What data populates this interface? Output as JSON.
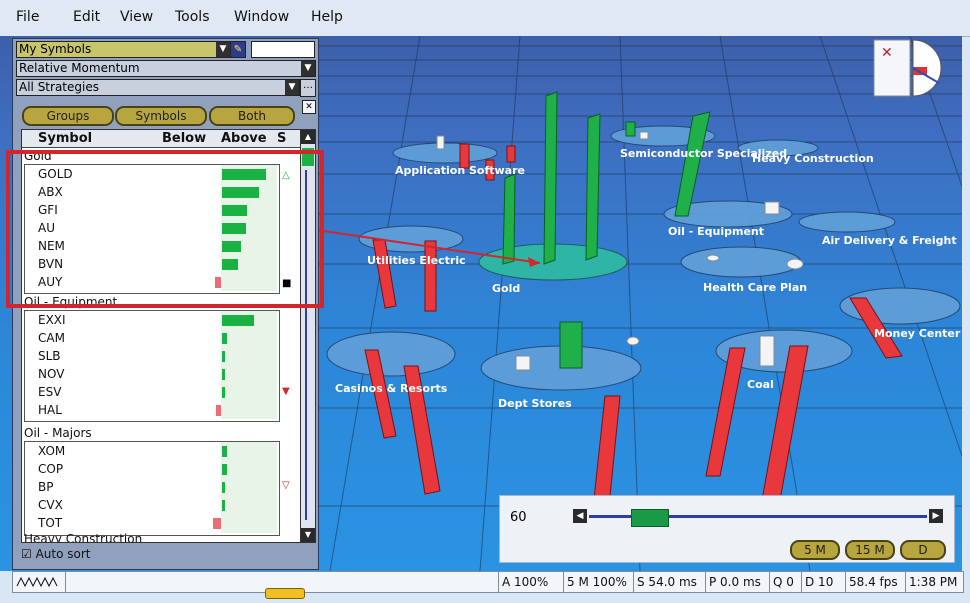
{
  "menu": [
    "File",
    "Edit",
    "View",
    "Tools",
    "Window",
    "Help"
  ],
  "panel": {
    "combo_symbols": "My Symbols",
    "combo_indicator": "Relative Momentum",
    "combo_strategy": "All Strategies",
    "btn_groups": "Groups",
    "btn_symbols": "Symbols",
    "btn_both": "Both",
    "col_symbol": "Symbol",
    "col_below": "Below",
    "col_above": "Above",
    "col_s": "S",
    "group_gold": "Gold",
    "group_oil_equipment": "Oil - Equipment",
    "group_oil_majors": "Oil - Majors",
    "group_heavy": "Heavy Construction",
    "autosort_label": "Auto sort",
    "rows_gold": [
      {
        "symbol": "GOLD",
        "above": 0.82
      },
      {
        "symbol": "ABX",
        "above": 0.68
      },
      {
        "symbol": "GFI",
        "above": 0.47
      },
      {
        "symbol": "AU",
        "above": 0.45
      },
      {
        "symbol": "NEM",
        "above": 0.35
      },
      {
        "symbol": "BVN",
        "above": 0.3
      },
      {
        "symbol": "AUY",
        "below": 0.12
      }
    ],
    "rows_oil_equipment": [
      {
        "symbol": "EXXI",
        "above": 0.59
      },
      {
        "symbol": "CAM",
        "above": 0.1
      },
      {
        "symbol": "SLB",
        "above": 0.03
      },
      {
        "symbol": "NOV",
        "above": 0.03
      },
      {
        "symbol": "ESV",
        "above": 0.03
      },
      {
        "symbol": "HAL",
        "below": 0.1
      }
    ],
    "rows_oil_majors": [
      {
        "symbol": "XOM",
        "above": 0.1
      },
      {
        "symbol": "COP",
        "above": 0.1
      },
      {
        "symbol": "BP",
        "above": 0.05
      },
      {
        "symbol": "CVX",
        "above": 0.05
      },
      {
        "symbol": "TOT",
        "below": 0.14
      }
    ]
  },
  "scene_labels": {
    "app_software": "Application Software",
    "semiconductor": "Semiconductor Specialized",
    "heavy_construction": "Heavy Construction",
    "oil_equipment": "Oil - Equipment",
    "air_delivery": "Air Delivery & Freight",
    "utilities": "Utilities Electric",
    "gold": "Gold",
    "health_care": "Health Care Plan",
    "money_center": "Money Center Banks",
    "casinos": "Casinos & Resorts",
    "dept_stores": "Dept Stores",
    "coal": "Coal"
  },
  "time_panel": {
    "value": "60",
    "slider_position": 0.14,
    "btn_5m": "5 M",
    "btn_15m": "15 M",
    "btn_d": "D"
  },
  "status": {
    "a": "A 100%",
    "m": "5 M 100%",
    "s": "S 54.0 ms",
    "p": "P 0.0 ms",
    "q": "Q 0",
    "d": "D 10",
    "fps": "58.4 fps",
    "time": "1:38 PM"
  },
  "colors": {
    "up": "#19b243",
    "down": "#ea6c76",
    "highlight": "#d3252c",
    "panel": "#8fa1bc"
  }
}
